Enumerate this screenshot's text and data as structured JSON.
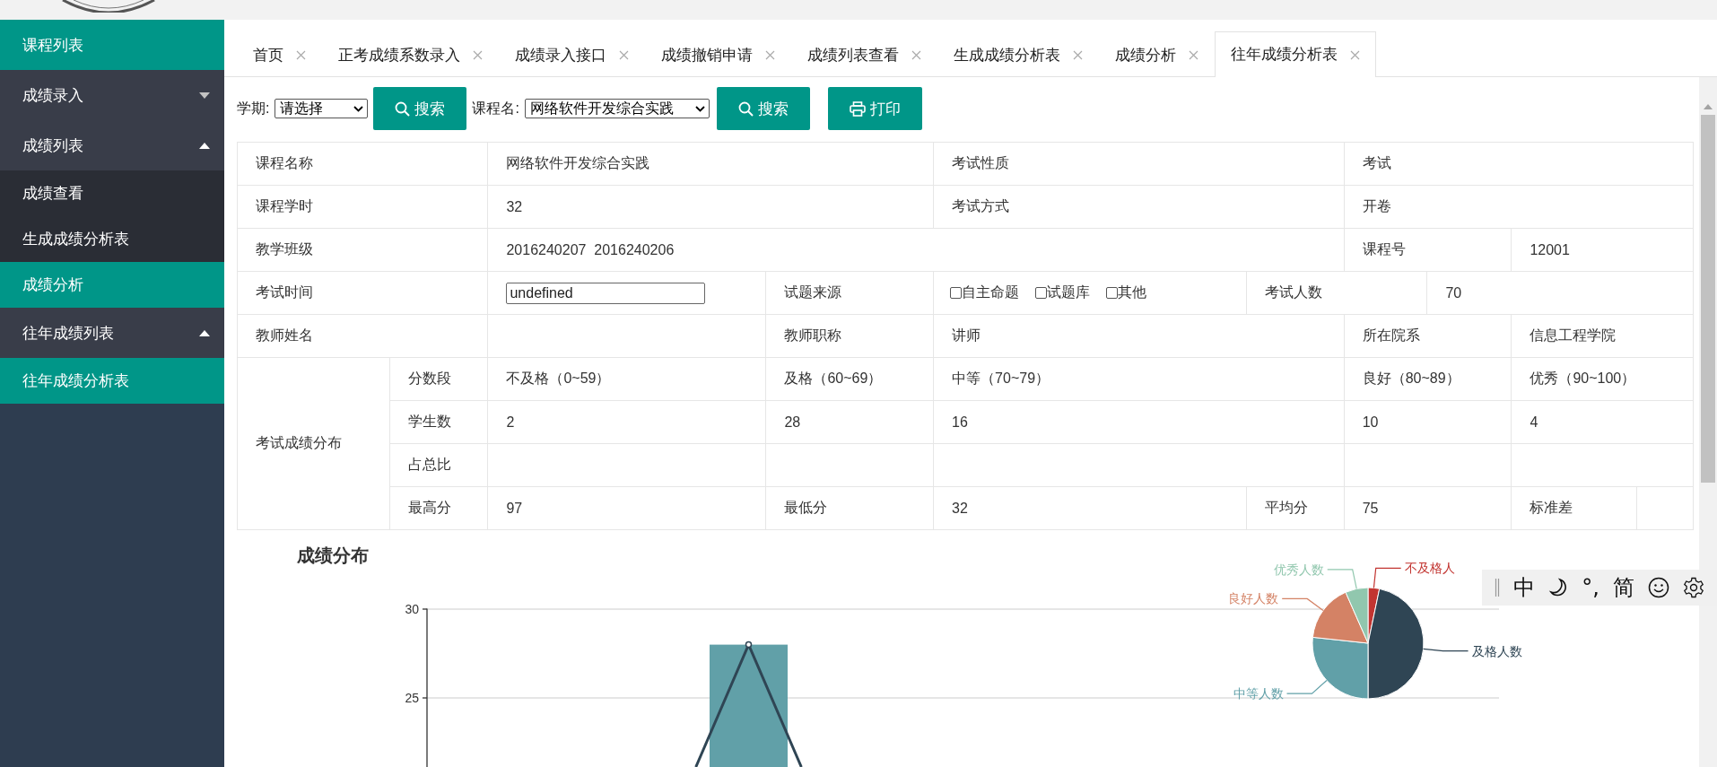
{
  "sidebar": {
    "items": [
      {
        "label": "课程列表",
        "kind": "link",
        "selected": true
      },
      {
        "label": "成绩录入",
        "kind": "group",
        "expanded": false,
        "selected": false
      },
      {
        "label": "成绩列表",
        "kind": "group",
        "expanded": true,
        "selected": false,
        "children": [
          {
            "label": "成绩查看",
            "selected": false
          },
          {
            "label": "生成成绩分析表",
            "selected": false
          },
          {
            "label": "成绩分析",
            "selected": true
          }
        ]
      },
      {
        "label": "往年成绩列表",
        "kind": "group",
        "expanded": true,
        "selected": false,
        "children": [
          {
            "label": "往年成绩分析表",
            "selected": true
          }
        ]
      }
    ]
  },
  "tabs": [
    {
      "label": "首页",
      "selected": false
    },
    {
      "label": "正考成绩系数录入",
      "selected": false
    },
    {
      "label": "成绩录入接口",
      "selected": false
    },
    {
      "label": "成绩撤销申请",
      "selected": false
    },
    {
      "label": "成绩列表查看",
      "selected": false
    },
    {
      "label": "生成成绩分析表",
      "selected": false
    },
    {
      "label": "成绩分析",
      "selected": false
    },
    {
      "label": "往年成绩分析表",
      "selected": true
    }
  ],
  "toolbar": {
    "term_label": "学期:",
    "term_value": "请选择",
    "search_button": "搜索",
    "course_label": "课程名:",
    "course_value": "网络软件开发综合实践",
    "course_search_button": "搜索",
    "print_button": "打印"
  },
  "course_info": {
    "rows": [
      {
        "fields": [
          {
            "kind": "text",
            "label": "课程名称",
            "value": "网络软件开发综合实践"
          },
          {
            "kind": "text",
            "label": "考试性质",
            "value": "考试"
          }
        ]
      },
      {
        "fields": [
          {
            "kind": "text",
            "label": "课程学时",
            "value": "32"
          },
          {
            "kind": "text",
            "label": "考试方式",
            "value": "开卷"
          }
        ]
      },
      {
        "fields": [
          {
            "kind": "text",
            "label": "教学班级",
            "value": "2016240207  2016240206"
          },
          {
            "kind": "text",
            "label": "课程号",
            "value": "12001"
          }
        ]
      },
      {
        "fields": [
          {
            "kind": "input",
            "label": "考试时间",
            "value": "undefined"
          },
          {
            "kind": "checkboxes",
            "label": "试题来源",
            "options": [
              {
                "label": "自主命题",
                "checked": false
              },
              {
                "label": "试题库",
                "checked": false
              },
              {
                "label": "其他",
                "checked": false
              }
            ]
          },
          {
            "kind": "text",
            "label": "考试人数",
            "value": "70"
          }
        ]
      },
      {
        "fields": [
          {
            "kind": "text",
            "label": "教师姓名"
          },
          {
            "kind": "text",
            "label": "教师职称",
            "value": "讲师"
          },
          {
            "kind": "text",
            "label": "所在院系",
            "value": "信息工程学院"
          }
        ]
      }
    ]
  },
  "distribution": {
    "title": "考试成绩分布",
    "rows": [
      {
        "label": "分数段",
        "cells": [
          "不及格（0~59）",
          "及格（60~69）",
          "中等（70~79）",
          "良好（80~89）",
          "优秀（90~100）"
        ]
      },
      {
        "label": "学生数",
        "cells": [
          "2",
          "28",
          "16",
          "10",
          "4"
        ]
      },
      {
        "label": "占总比"
      }
    ],
    "stats": [
      {
        "label": "最高分",
        "value": "97"
      },
      {
        "label": "最低分",
        "value": "32"
      },
      {
        "label": "平均分",
        "value": "75"
      },
      {
        "label": "标准差"
      }
    ]
  },
  "bar_chart": {
    "chart_data": {
      "type": "bar",
      "title": "成绩分布",
      "ylim": [
        0,
        30
      ],
      "yticks": [
        25,
        30
      ],
      "series": [
        {
          "color": "#61a0a8",
          "values": [
            null,
            28,
            null,
            null,
            null
          ]
        }
      ]
    }
  },
  "pie_chart": {
    "chart_data": {
      "type": "pie",
      "categories": [
        "不及格人",
        "及格人数",
        "中等人数",
        "良好人数",
        "优秀人数"
      ],
      "series": [
        {
          "values": [
            3.3,
            46.7,
            26.7,
            16.7,
            6.6
          ],
          "colors": [
            "#c23531",
            "#2f4554",
            "#61a0a8",
            "#d48265",
            "#91c7ae"
          ]
        }
      ]
    }
  },
  "ime_toolbar": {
    "mode": "中",
    "punctuation": "°,",
    "script": "简"
  }
}
